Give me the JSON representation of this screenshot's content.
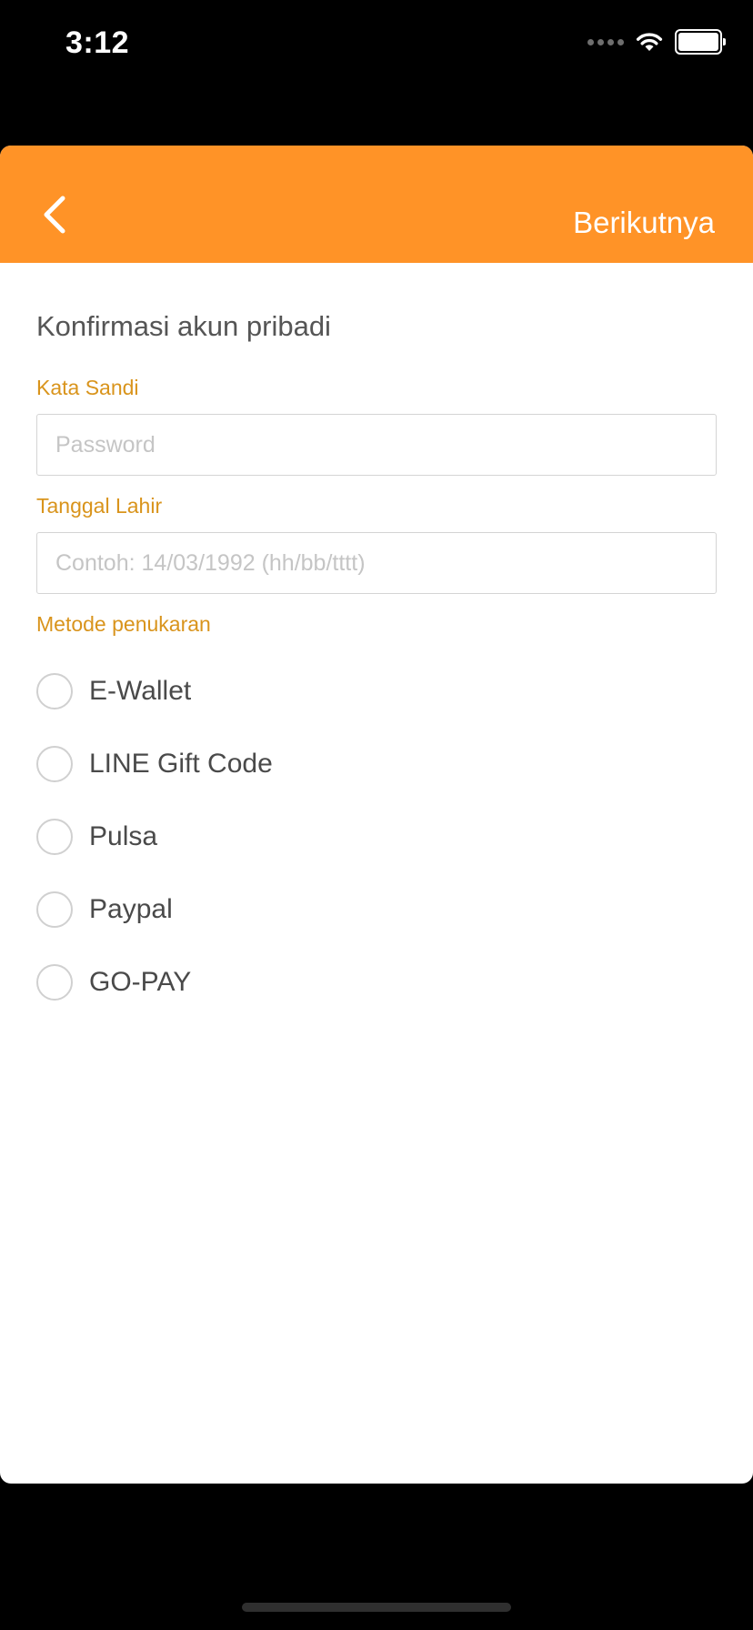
{
  "status_bar": {
    "time": "3:12",
    "icons": [
      "signal-icon",
      "wifi-icon",
      "battery-icon"
    ]
  },
  "nav": {
    "back_icon": "chevron-left-icon",
    "next_label": "Berikutnya"
  },
  "form": {
    "title": "Konfirmasi akun pribadi",
    "password_label": "Kata Sandi",
    "password_placeholder": "Password",
    "birthdate_label": "Tanggal Lahir",
    "birthdate_placeholder": "Contoh: 14/03/1992 (hh/bb/tttt)",
    "method_label": "Metode penukaran",
    "methods": [
      {
        "label": "E-Wallet"
      },
      {
        "label": "LINE Gift Code"
      },
      {
        "label": "Pulsa"
      },
      {
        "label": "Paypal"
      },
      {
        "label": "GO-PAY"
      }
    ]
  },
  "colors": {
    "accent": "#ff9327",
    "label": "#d9941c",
    "text": "#4a4a4a",
    "placeholder": "#c5c5c5"
  }
}
